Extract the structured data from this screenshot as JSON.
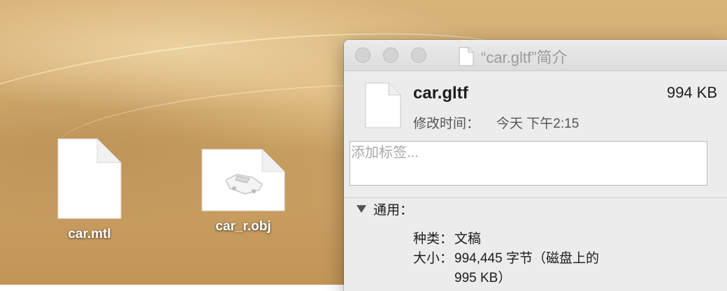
{
  "desktop": {
    "files": [
      {
        "name": "car.mtl"
      },
      {
        "name": "car_r.obj"
      }
    ]
  },
  "info_window": {
    "title": "“car.gltf”简介",
    "file_name": "car.gltf",
    "file_size": "994 KB",
    "modified_label": "修改时间：",
    "modified_value": "今天 下午2:15",
    "tags_placeholder": "添加标签...",
    "section_general": "通用：",
    "kind_label": "种类：",
    "kind_value": "文稿",
    "size_label": "大小：",
    "size_value_line1": "994,445 字节（磁盘上的",
    "size_value_line2": "995 KB）"
  },
  "colors": {
    "sand": "#d1aa6e",
    "window_bg": "#ececec",
    "traffic_inactive": "#d3d3d3"
  }
}
